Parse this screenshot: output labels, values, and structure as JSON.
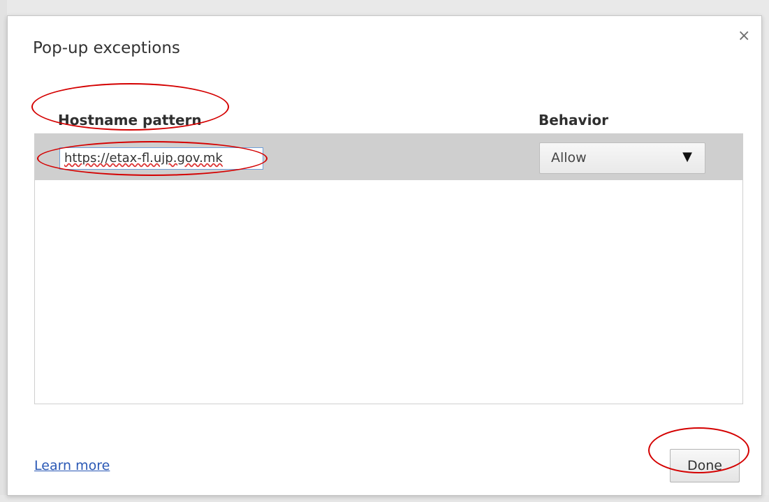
{
  "dialog": {
    "title": "Pop-up exceptions",
    "close_glyph": "×"
  },
  "table": {
    "col_hostname": "Hostname pattern",
    "col_behavior": "Behavior",
    "rows": [
      {
        "hostname": "https://etax-fl.ujp.gov.mk",
        "behavior": "Allow"
      }
    ]
  },
  "footer": {
    "learn_more": "Learn more",
    "done_label": "Done"
  },
  "icons": {
    "close": "close-icon",
    "dropdown": "chevron-down-icon"
  },
  "colors": {
    "selected_row": "#cfcfcf",
    "link": "#2a58b5",
    "annotation": "#d40000"
  }
}
